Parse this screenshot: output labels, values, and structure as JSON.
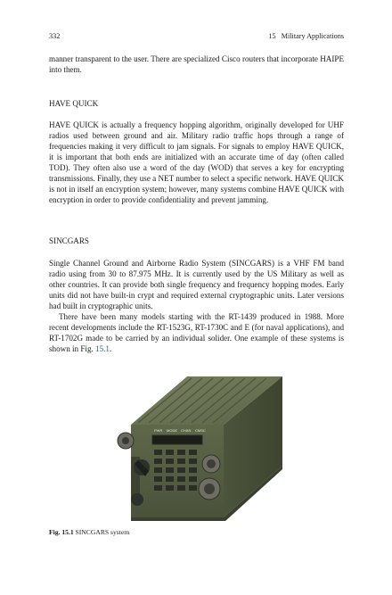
{
  "header": {
    "page_number": "332",
    "running_title": "15   Military Applications"
  },
  "intro_paragraph": "manner transparent to the user. There are specialized Cisco routers that incorporate HAIPE into them.",
  "section_have_quick": {
    "heading": "HAVE QUICK",
    "body": "HAVE QUICK is actually a frequency hopping algorithm, originally developed for UHF radios used between ground and air. Military radio traffic hops through a range of frequencies making it very difficult to jam signals. For signals to employ HAVE QUICK, it is important that both ends are initialized with an accurate time of day (often called TOD). They often also use a word of the day (WOD) that serves a key for encrypting transmissions. Finally, they use a NET number to select a specific network. HAVE QUICK is not in itself an encryption system; however, many systems combine HAVE QUICK with encryption in order to provide confidentiality and prevent jamming."
  },
  "section_sincgars": {
    "heading": "SINCGARS",
    "body1": "Single Channel Ground and Airborne Radio System (SINCGARS) is a VHF FM band radio using from 30 to 87.975 MHz. It is currently used by the US Military as well as other countries. It can provide both single frequency and frequency hopping modes. Early units did not have built-in crypt and required external cryptographic units. Later versions had built in cryptographic units.",
    "body2": "There have been many models starting with the RT-1439 produced in 1988. More recent developments include the RT-1523G, RT-1730C and E (for naval applications), and RT-1702G made to be carried by an individual solider. One example of these systems is shown in Fig. ",
    "body2_ref": "15.1",
    "body2_end": "."
  },
  "figure": {
    "panel_labels": [
      "PWR",
      "MODE",
      "CHAN",
      "CMSC"
    ],
    "caption_label": "Fig. 15.1",
    "caption_text": "SINCGARS system"
  },
  "colors": {
    "radio_body": "#5c6648",
    "link": "#2a5fa8"
  }
}
